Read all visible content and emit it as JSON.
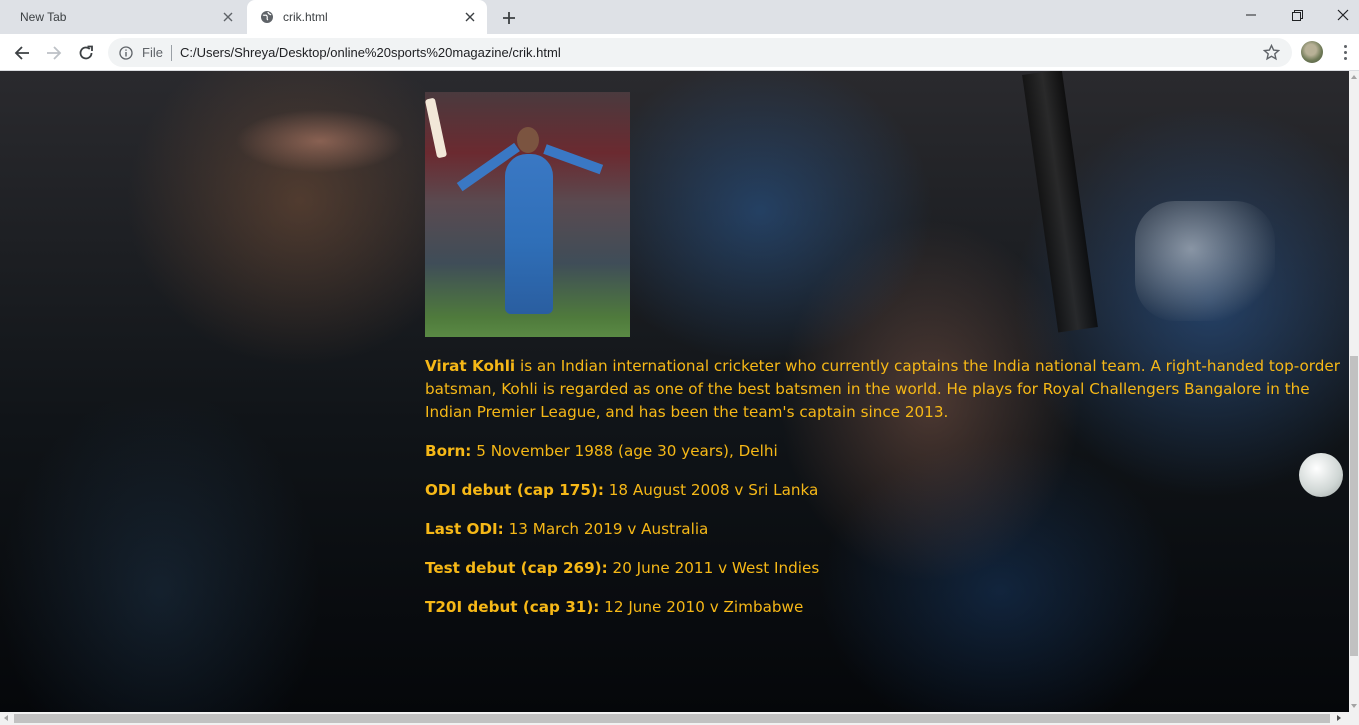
{
  "browser": {
    "tabs": [
      {
        "title": "New Tab",
        "active": false
      },
      {
        "title": "crik.html",
        "active": true
      }
    ],
    "new_tab_symbol": "+",
    "address": {
      "scheme_label": "File",
      "url": "C:/Users/Shreya/Desktop/online%20sports%20magazine/crik.html"
    },
    "icons": [
      "back-icon",
      "forward-icon",
      "reload-icon",
      "info-icon",
      "star-icon",
      "avatar",
      "menu-icon",
      "minimize-icon",
      "maximize-icon",
      "close-icon",
      "globe-icon"
    ]
  },
  "page": {
    "text_color": "#f6b817",
    "intro": {
      "name": "Virat Kohli",
      "text": " is an Indian international cricketer who currently captains the India national team. A right-handed top-order batsman, Kohli is regarded as one of the best batsmen in the world. He plays for Royal Challengers Bangalore in the Indian Premier League, and has been the team's captain since 2013."
    },
    "facts": [
      {
        "label": "Born:",
        "value": " 5 November 1988 (age 30 years), Delhi"
      },
      {
        "label": "ODI debut (cap 175):",
        "value": " 18 August 2008 v Sri Lanka"
      },
      {
        "label": "Last ODI:",
        "value": " 13 March 2019 v Australia"
      },
      {
        "label": "Test debut (cap 269):",
        "value": " 20 June 2011 v West Indies"
      },
      {
        "label": "T20I debut (cap 31):",
        "value": " 12 June 2010 v Zimbabwe"
      }
    ]
  }
}
